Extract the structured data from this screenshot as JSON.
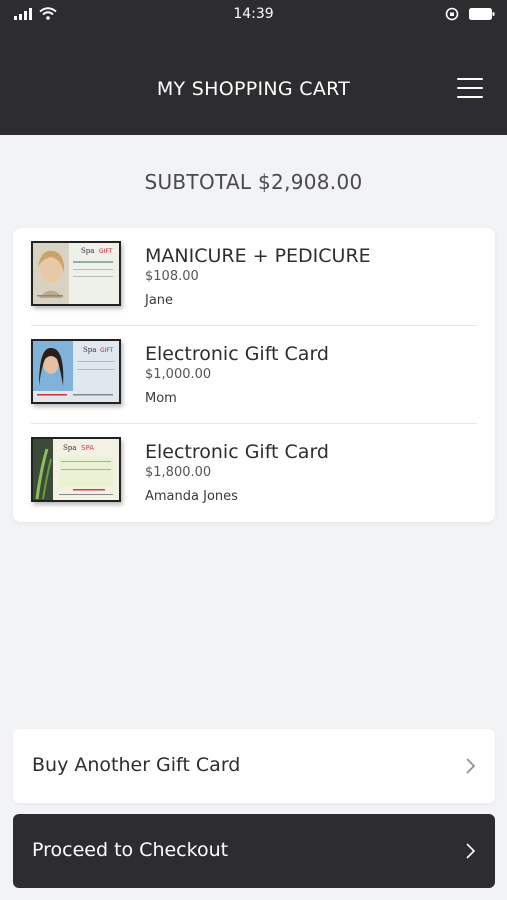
{
  "status": {
    "time": "14:39",
    "icons": [
      "signal-icon",
      "wifi-icon",
      "rotation-lock-icon",
      "battery-icon"
    ]
  },
  "header": {
    "title": "MY SHOPPING CART",
    "menu_icon": "hamburger-menu-icon"
  },
  "cart": {
    "subtotal": "SUBTOTAL $2,908.00",
    "items": [
      {
        "name": "MANICURE + PEDICURE",
        "price": "$108.00",
        "recipient": "Jane",
        "thumb": "gift-card-thumbnail-woman"
      },
      {
        "name": "Electronic Gift Card",
        "price": "$1,000.00",
        "recipient": "Mom",
        "thumb": "gift-card-thumbnail-dark-hair"
      },
      {
        "name": "Electronic Gift Card",
        "price": "$1,800.00",
        "recipient": "Amanda Jones",
        "thumb": "gift-card-thumbnail-spa"
      }
    ]
  },
  "actions": {
    "buy_another": "Buy Another Gift Card",
    "checkout": "Proceed to Checkout"
  },
  "colors": {
    "header_bg": "#2d2d30",
    "page_bg": "#f2f3f5",
    "card_bg": "#ffffff",
    "checkout_bg": "#2d2d30"
  }
}
